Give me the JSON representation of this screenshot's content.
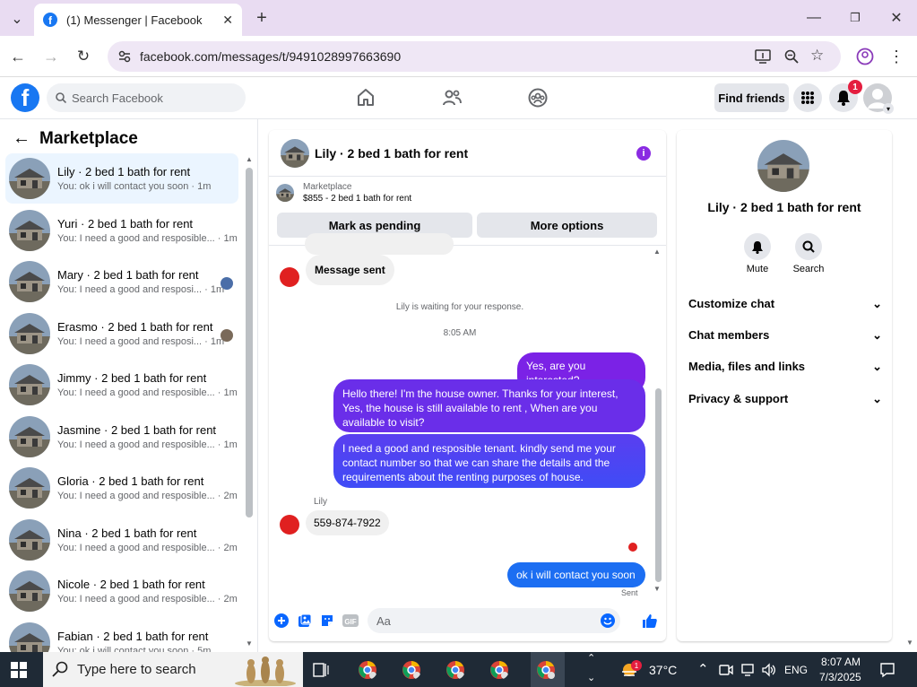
{
  "browser": {
    "tab_title": "(1) Messenger | Facebook",
    "url": "facebook.com/messages/t/9491028997663690"
  },
  "fb": {
    "search_placeholder": "Search Facebook",
    "find_friends": "Find friends",
    "notif_count": "1"
  },
  "left": {
    "title": "Marketplace",
    "conversations": [
      {
        "name": "Lily · 2 bed 1 bath for rent",
        "preview": "You: ok i will contact you soon · 1m",
        "active": true
      },
      {
        "name": "Yuri · 2 bed 1 bath for rent",
        "preview": "You: I need a good and resposible... · 1m"
      },
      {
        "name": "Mary · 2 bed 1 bath for rent",
        "preview": "You: I need a good and resposi... · 1m"
      },
      {
        "name": "Erasmo · 2 bed 1 bath for rent",
        "preview": "You: I need a good and resposi... · 1m"
      },
      {
        "name": "Jimmy · 2 bed 1 bath for rent",
        "preview": "You: I need a good and resposible... · 1m"
      },
      {
        "name": "Jasmine · 2 bed 1 bath for rent",
        "preview": "You: I need a good and resposible... · 1m"
      },
      {
        "name": "Gloria · 2 bed 1 bath for rent",
        "preview": "You: I need a good and resposible... · 2m"
      },
      {
        "name": "Nina · 2 bed 1 bath for rent",
        "preview": "You: I need a good and resposible... · 2m"
      },
      {
        "name": "Nicole · 2 bed 1 bath for rent",
        "preview": "You: I need a good and resposible... · 2m"
      },
      {
        "name": "Fabian · 2 bed 1 bath for rent",
        "preview": "You: ok i will contact you soon · 5m"
      }
    ]
  },
  "chat": {
    "title": "Lily · 2 bed 1 bath for rent",
    "mp_label": "Marketplace",
    "mp_item": "$855 - 2 bed 1 bath for rent",
    "mark_pending": "Mark as pending",
    "more_options": "More options",
    "message_sent": "Message sent",
    "waiting": "Lily is waiting for your response.",
    "time": "8:05 AM",
    "out1": "Yes, are you interested?",
    "out2": "Hello there! I'm the house owner. Thanks for your interest, Yes, the house is still available to rent , When are you available to visit?",
    "out3": "I need a good and resposible tenant.  kindly send me your contact number so that we can share the details and the requirements about the renting purposes of house.",
    "sender": "Lily",
    "in1": "559-874-7922",
    "out4": "ok i will contact you soon",
    "sent": "Sent",
    "composer_placeholder": "Aa"
  },
  "right": {
    "name": "Lily · 2 bed 1 bath for rent",
    "mute": "Mute",
    "search": "Search",
    "sections": [
      "Customize chat",
      "Chat members",
      "Media, files and links",
      "Privacy & support"
    ]
  },
  "taskbar": {
    "search_placeholder": "Type here to search",
    "temp": "37°C",
    "lang": "ENG",
    "time": "8:07 AM",
    "date": "7/3/2025",
    "weather_badge": "1"
  },
  "colors": {
    "fb_blue": "#1877f2",
    "outgoing_top": "#7b22e6",
    "outgoing_bottom": "#4a4cf5"
  }
}
